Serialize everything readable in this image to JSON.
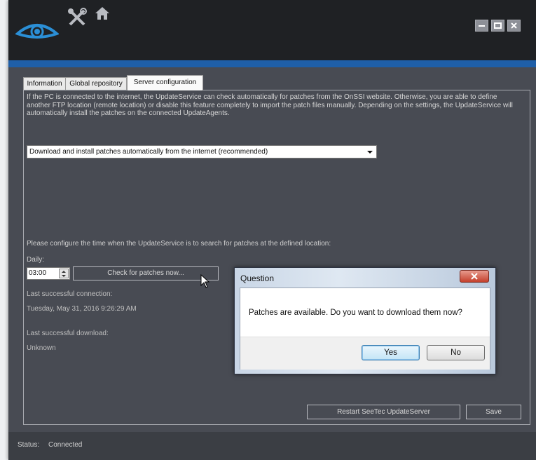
{
  "icons": {
    "logo": "eye-logo-icon",
    "tools": "tools-icon",
    "home": "home-icon",
    "minimize": "minimize-icon",
    "maximize": "maximize-icon",
    "close": "close-icon"
  },
  "colors": {
    "accent_strip": "#1f5fa8",
    "logo_blue": "#2b8fd6",
    "window_bg": "#484b53",
    "titlebar": "#1f2124"
  },
  "tabs": [
    {
      "label": "Information"
    },
    {
      "label": "Global repository"
    },
    {
      "label": "Server configuration",
      "active": true
    }
  ],
  "server_config": {
    "intro": "If the PC is connected to the internet, the UpdateService can check automatically for patches from the OnSSI website. Otherwise, you are able to define another FTP location (remote location) or disable this feature completely to import the patch files manually. Depending on the settings, the UpdateService will automatically install the patches on the connected UpdateAgents.",
    "download_option": "Download and install patches automatically from the internet (recommended)",
    "configure_label": "Please configure the time when the UpdateService is to search for patches at the defined location:",
    "daily_label": "Daily:",
    "time_value": "03:00",
    "check_button": "Check for patches now...",
    "last_connection_label": "Last successful connection:",
    "last_connection_value": "Tuesday, May 31, 2016 9:26:29 AM",
    "last_download_label": "Last successful download:",
    "last_download_value": "Unknown",
    "restart_button": "Restart SeeTec UpdateServer",
    "save_button": "Save"
  },
  "status": {
    "label": "Status:",
    "value": "Connected"
  },
  "dialog": {
    "title": "Question",
    "message": "Patches are available. Do you want to download them now?",
    "yes_label": "Yes",
    "no_label": "No"
  }
}
